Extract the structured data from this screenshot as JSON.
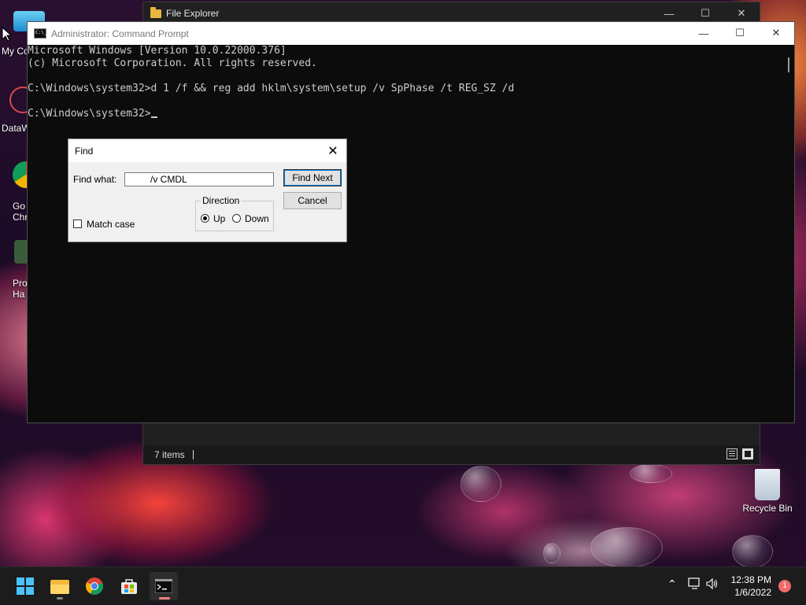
{
  "desktop": {
    "icons": [
      {
        "label": "My Co"
      },
      {
        "label": "DataW"
      },
      {
        "label": "Go\nChr"
      },
      {
        "label": "Pro\nHa"
      },
      {
        "label": "Recycle Bin"
      }
    ]
  },
  "explorer": {
    "title": "File Explorer",
    "status_count": "7 items"
  },
  "cmd": {
    "title": "Administrator: Command Prompt",
    "lines": [
      "Microsoft Windows [Version 10.0.22000.376]",
      "(c) Microsoft Corporation. All rights reserved.",
      "",
      "C:\\Windows\\system32>d 1 /f && reg add hklm\\system\\setup /v SpPhase /t REG_SZ /d",
      "",
      "C:\\Windows\\system32>"
    ]
  },
  "find_dialog": {
    "title": "Find",
    "find_what_label": "Find what:",
    "find_what_value": "/v CMDL",
    "find_next_label": "Find Next",
    "cancel_label": "Cancel",
    "direction_label": "Direction",
    "up_label": "Up",
    "down_label": "Down",
    "direction_selected": "Up",
    "match_case_label": "Match case",
    "match_case_checked": false
  },
  "taskbar": {
    "apps": [
      "start-icon",
      "file-explorer-icon",
      "chrome-icon",
      "microsoft-store-icon",
      "command-prompt-icon"
    ],
    "active_app": "command-prompt-icon",
    "time": "12:38 PM",
    "date": "1/6/2022",
    "notification_count": "1"
  },
  "colors": {
    "console_bg": "#0c0c0c",
    "console_text": "#cccccc",
    "taskbar_bg": "#1c1c1c",
    "notification_badge": "#f06a6a"
  }
}
